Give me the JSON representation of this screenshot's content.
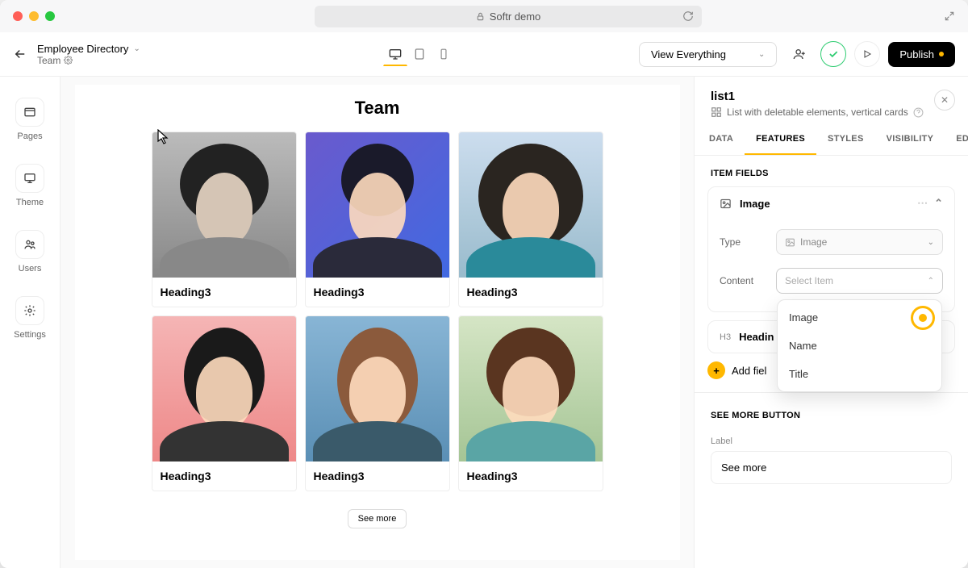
{
  "titlebar": {
    "url_label": "Softr demo"
  },
  "appbar": {
    "project_name": "Employee Directory",
    "page_name": "Team",
    "view_label": "View Everything",
    "publish_label": "Publish"
  },
  "leftbar": {
    "items": [
      {
        "label": "Pages"
      },
      {
        "label": "Theme"
      },
      {
        "label": "Users"
      },
      {
        "label": "Settings"
      }
    ]
  },
  "canvas": {
    "title": "Team",
    "card_label": "Heading3",
    "see_more": "See more"
  },
  "rightpanel": {
    "block_name": "list1",
    "block_desc": "List with deletable elements, vertical cards",
    "tabs": [
      "DATA",
      "FEATURES",
      "STYLES",
      "VISIBILITY",
      "EDIT"
    ],
    "active_tab": "FEATURES",
    "section_item_fields": "ITEM FIELDS",
    "image_field": {
      "title": "Image",
      "type_label": "Type",
      "type_value": "Image",
      "content_label": "Content",
      "content_placeholder": "Select Item",
      "dropdown_options": [
        "Image",
        "Name",
        "Title"
      ]
    },
    "heading_field_title_prefix": "Headin",
    "add_field_label": "Add fiel",
    "see_more_section": "SEE MORE BUTTON",
    "see_more_label_caption": "Label",
    "see_more_value": "See more"
  }
}
